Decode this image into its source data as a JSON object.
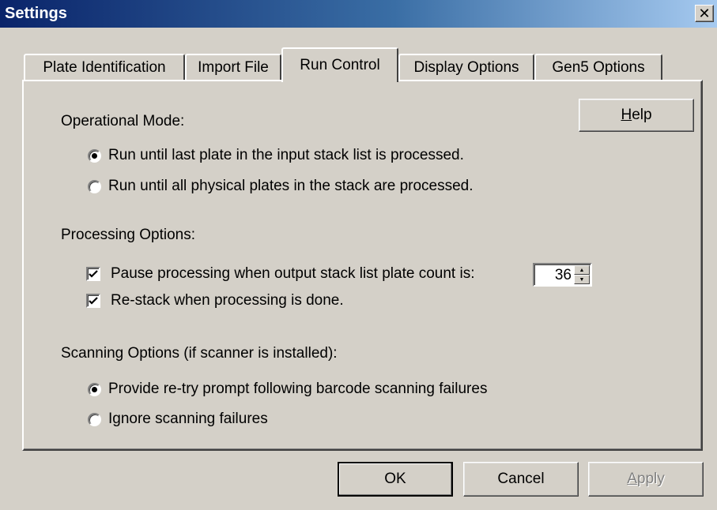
{
  "window": {
    "title": "Settings"
  },
  "tabs": [
    {
      "label": "Plate Identification"
    },
    {
      "label": "Import File"
    },
    {
      "label": "Run Control"
    },
    {
      "label": "Display Options"
    },
    {
      "label": "Gen5 Options"
    }
  ],
  "help_button": {
    "label_pre": "",
    "mnemonic": "H",
    "label_post": "elp"
  },
  "operational_mode": {
    "heading": "Operational Mode:",
    "options": [
      {
        "label": "Run until last plate in the input stack list is processed.",
        "selected": true
      },
      {
        "label": "Run until all physical plates in the stack are processed.",
        "selected": false
      }
    ]
  },
  "processing_options": {
    "heading": "Processing Options:",
    "pause": {
      "label": "Pause processing when output stack list plate count is:",
      "checked": true,
      "count": "36"
    },
    "restack": {
      "label": "Re-stack when processing is done.",
      "checked": true
    }
  },
  "scanning_options": {
    "heading": "Scanning Options (if scanner is installed):",
    "options": [
      {
        "label": "Provide re-try prompt following barcode scanning failures",
        "selected": true
      },
      {
        "label": "Ignore scanning failures",
        "selected": false
      }
    ]
  },
  "footer": {
    "ok": "OK",
    "cancel": "Cancel",
    "apply_mnemonic": "A",
    "apply_rest": "pply"
  }
}
